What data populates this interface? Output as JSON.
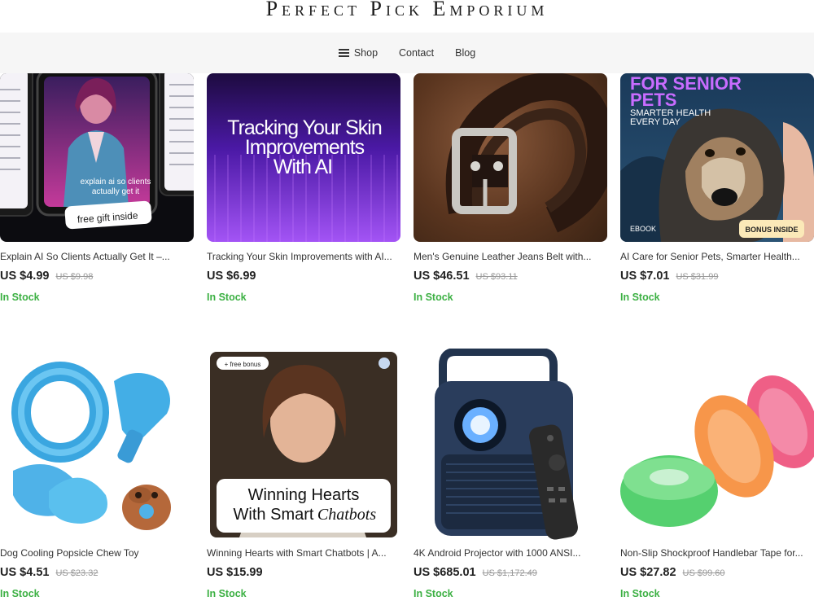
{
  "store": {
    "name": "Perfect Pick Emporium"
  },
  "nav": {
    "items": [
      {
        "label": "Shop"
      },
      {
        "label": "Contact"
      },
      {
        "label": "Blog"
      }
    ]
  },
  "products": [
    {
      "title": "Explain AI So Clients Actually Get It –...",
      "price": "US $4.99",
      "old_price": "US $9.98",
      "stock": "In Stock",
      "image_text": {
        "line1": "explain ai so clients",
        "line2": "actually get it",
        "tag": "free gift inside"
      }
    },
    {
      "title": "Tracking Your Skin Improvements with AI...",
      "price": "US $6.99",
      "old_price": "",
      "stock": "In Stock",
      "image_text": {
        "line1": "Tracking Your Skin",
        "line2": "Improvements",
        "line3": "With AI"
      }
    },
    {
      "title": "Men's Genuine Leather Jeans Belt with...",
      "price": "US $46.51",
      "old_price": "US $93.11",
      "stock": "In Stock"
    },
    {
      "title": "AI Care for Senior Pets, Smarter Health...",
      "price": "US $7.01",
      "old_price": "US $31.99",
      "stock": "In Stock",
      "image_text": {
        "headline1": "FOR SENIOR",
        "headline2": "PETS",
        "sub1": "SMARTER HEALTH",
        "sub2": "EVERY DAY",
        "ebook": "EBOOK",
        "bonus": "BONUS INSIDE"
      }
    },
    {
      "title": "Dog Cooling Popsicle Chew Toy",
      "price": "US $4.51",
      "old_price": "US $23.32",
      "stock": "In Stock"
    },
    {
      "title": "Winning Hearts with Smart Chatbots | A...",
      "price": "US $15.99",
      "old_price": "",
      "stock": "In Stock",
      "image_text": {
        "badge": "+ free bonus",
        "line1": "Winning Hearts",
        "line2": "With Smart",
        "line2b": "Chatbots"
      }
    },
    {
      "title": "4K Android Projector with 1000 ANSI...",
      "price": "US $685.01",
      "old_price": "US $1,172.49",
      "stock": "In Stock"
    },
    {
      "title": "Non-Slip Shockproof Handlebar Tape for...",
      "price": "US $27.82",
      "old_price": "US $99.60",
      "stock": "In Stock"
    }
  ],
  "colors": {
    "in_stock": "#3cb043",
    "nav_bg": "#f6f6f6"
  }
}
